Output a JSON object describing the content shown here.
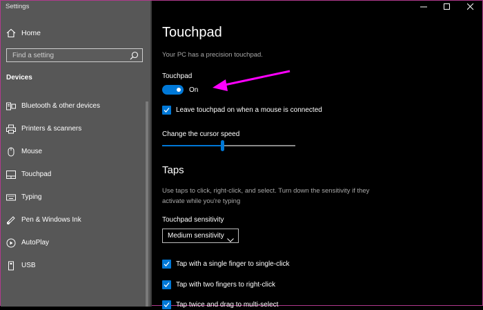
{
  "window": {
    "title": "Settings"
  },
  "sidebar": {
    "home_label": "Home",
    "search_placeholder": "Find a setting",
    "section_title": "Devices",
    "items": [
      {
        "label": "Bluetooth & other devices",
        "icon": "bluetooth-devices-icon"
      },
      {
        "label": "Printers & scanners",
        "icon": "printer-icon"
      },
      {
        "label": "Mouse",
        "icon": "mouse-icon"
      },
      {
        "label": "Touchpad",
        "icon": "touchpad-icon"
      },
      {
        "label": "Typing",
        "icon": "keyboard-icon"
      },
      {
        "label": "Pen & Windows Ink",
        "icon": "pen-icon"
      },
      {
        "label": "AutoPlay",
        "icon": "autoplay-icon"
      },
      {
        "label": "USB",
        "icon": "usb-icon"
      }
    ]
  },
  "main": {
    "title": "Touchpad",
    "precision_text": "Your PC has a precision touchpad.",
    "toggle_label": "Touchpad",
    "toggle_state": "On",
    "leave_on_label": "Leave touchpad on when a mouse is connected",
    "cursor_speed_label": "Change the cursor speed",
    "cursor_speed_value": 0.45,
    "taps_heading": "Taps",
    "taps_desc": "Use taps to click, right-click, and select. Turn down the sensitivity if they activate while you're typing",
    "sensitivity_label": "Touchpad sensitivity",
    "sensitivity_value": "Medium sensitivity",
    "tap_single_label": "Tap with a single finger to single-click",
    "tap_two_label": "Tap with two fingers to right-click",
    "tap_drag_label": "Tap twice and drag to multi-select"
  },
  "colors": {
    "accent": "#0078d7",
    "annotation_arrow": "#ff00ff",
    "sidebar_bg": "#575757"
  }
}
